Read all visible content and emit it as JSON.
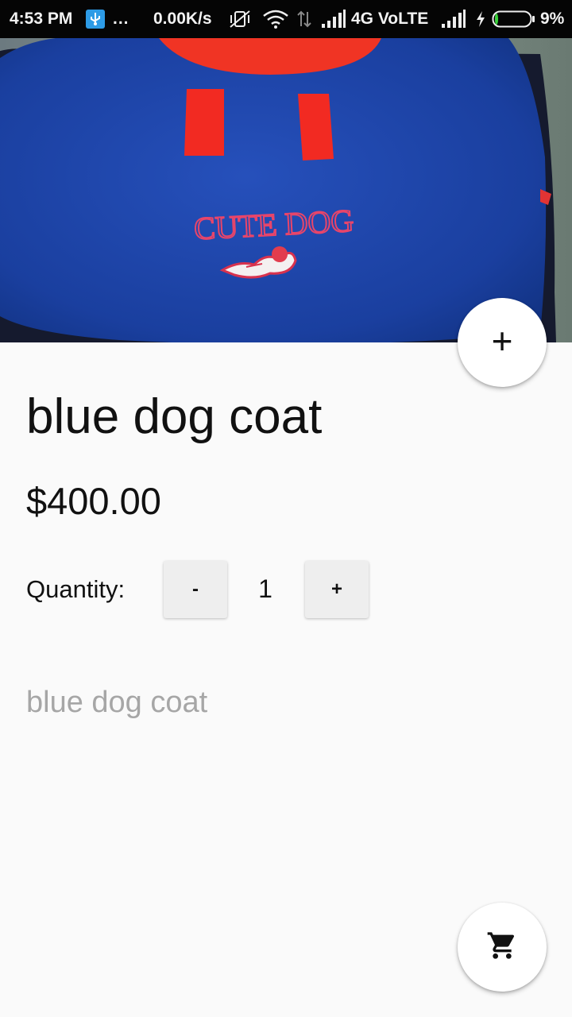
{
  "status_bar": {
    "time": "4:53 PM",
    "dots": "...",
    "speed": "0.00K/s",
    "network": "4G VoLTE",
    "battery_pct": "9%",
    "battery_level": 0.09
  },
  "hero": {
    "image_label": "CUTE DOG"
  },
  "product": {
    "title": "blue dog coat",
    "price": "$400.00",
    "quantity_label": "Quantity:",
    "decrement_label": "-",
    "quantity": "1",
    "increment_label": "+",
    "description": "blue dog coat"
  },
  "fab_add": {
    "glyph": "+",
    "icon": "plus-icon"
  },
  "fab_cart": {
    "icon": "cart-icon"
  },
  "colors": {
    "coat_blue": "#1b3fa3",
    "accent_red": "#f02a2a",
    "background": "#fafafa",
    "muted_text": "#a6a6a6"
  }
}
